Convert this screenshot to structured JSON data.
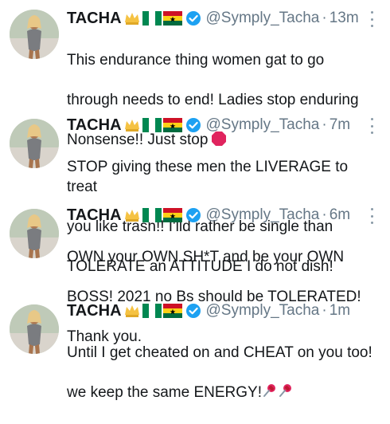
{
  "tweets": [
    {
      "name": "TACHA",
      "handle": "@Symply_Tacha",
      "separator": "·",
      "time": "13m",
      "lines": [
        "This endurance thing women gat to go",
        "through needs to end! Ladies stop enduring",
        "Nonsense!! Just stop"
      ],
      "end_emoji": "stop-sign"
    },
    {
      "name": "TACHA",
      "handle": "@Symply_Tacha",
      "separator": "·",
      "time": "7m",
      "lines": [
        "STOP giving these men the LIVERAGE to treat",
        "you like trash!! I'lld rather be single than",
        "TOLERATE an ATTITUDE I do not dish!"
      ]
    },
    {
      "name": "TACHA",
      "handle": "@Symply_Tacha",
      "separator": "·",
      "time": "6m",
      "lines": [
        "OWN your OWN SH*T and be your OWN",
        "BOSS! 2021 no Bs should be TOLERATED!",
        "Thank you."
      ]
    },
    {
      "name": "TACHA",
      "handle": "@Symply_Tacha",
      "separator": "·",
      "time": "1m",
      "lines": [
        "Until I get cheated on and CHEAT on you too!",
        "we keep the same ENERGY!"
      ],
      "end_emoji": "pushpin-pair"
    }
  ],
  "colors": {
    "text": "#14171a",
    "muted": "#657786",
    "verified": "#1da1f2",
    "stop": "#e0245e",
    "nigeria_green": "#008751",
    "ghana_red": "#ce1126",
    "ghana_gold": "#fcd116",
    "ghana_green": "#006b3f"
  },
  "icons": [
    "avatar",
    "crown-icon",
    "nigeria-flag-icon",
    "ghana-flag-icon",
    "verified-badge-icon",
    "more-options-icon",
    "stop-sign-icon",
    "pushpin-icon"
  ]
}
